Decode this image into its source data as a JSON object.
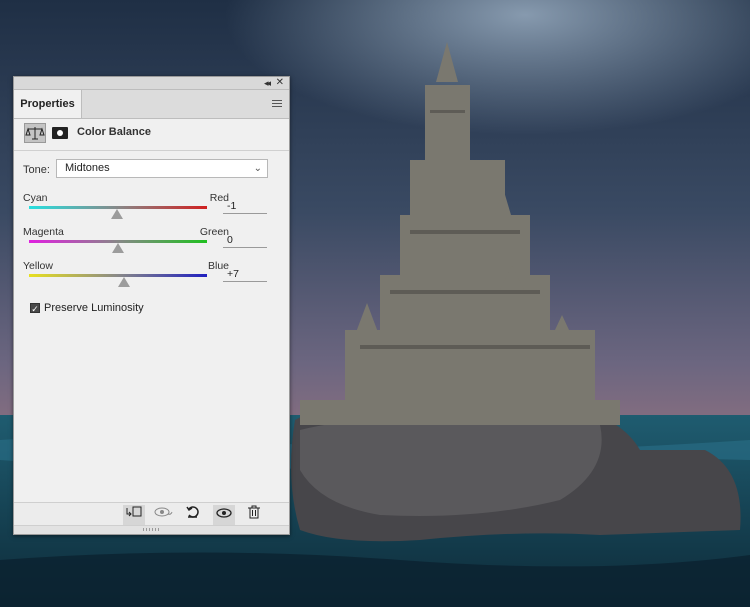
{
  "panel": {
    "collapse_label": "◂◂",
    "close_label": "✕",
    "tab_label": "Properties",
    "header_title": "Color Balance",
    "tone_label": "Tone:",
    "tone_value": "Midtones",
    "sliders": [
      {
        "left": "Cyan",
        "right": "Red",
        "value": "-1",
        "level": -1,
        "colors": [
          "#27e0e0",
          "#d02020"
        ]
      },
      {
        "left": "Magenta",
        "right": "Green",
        "value": "0",
        "level": 0,
        "colors": [
          "#e020e0",
          "#20c020"
        ]
      },
      {
        "left": "Yellow",
        "right": "Blue",
        "value": "+7",
        "level": 7,
        "colors": [
          "#e8e020",
          "#2020c0"
        ]
      }
    ],
    "preserve_label": "Preserve Luminosity",
    "preserve_checked": true,
    "bottom_buttons": [
      {
        "name": "clip-to-layer-icon",
        "glyph": "↲□"
      },
      {
        "name": "view-previous-state-icon",
        "glyph": "◉"
      },
      {
        "name": "reset-icon",
        "glyph": "↺"
      },
      {
        "name": "visibility-eye-icon",
        "glyph": "👁"
      },
      {
        "name": "trash-icon",
        "glyph": "🗑"
      }
    ]
  },
  "canvas": {
    "icon": "sand-castle-image"
  }
}
